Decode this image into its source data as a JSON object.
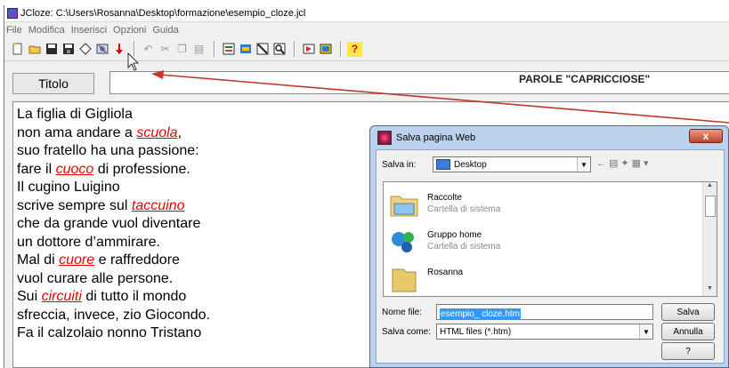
{
  "window": {
    "title": "JCloze: C:\\Users\\Rosanna\\Desktop\\formazione\\esempio_cloze.jcl"
  },
  "menu": [
    "File",
    "Modifica",
    "Inserisci",
    "Opzioni",
    "Guida"
  ],
  "toolbar": {
    "icons": [
      "new-file-icon",
      "open-folder-icon",
      "save-icon",
      "save-as-icon",
      "eraser-icon",
      "export-web-icon",
      "arrow-down-icon",
      "undo-icon",
      "cut-icon",
      "copy-icon",
      "paste-icon",
      "gap-icon",
      "gap-edit-icon",
      "clear-gap-icon",
      "find-gap-icon",
      "config-icon",
      "export-icon",
      "help-icon"
    ],
    "help_label": "?"
  },
  "title_row": {
    "button_label": "Titolo",
    "value": "PAROLE \"CAPRICCIOSE\""
  },
  "poem": [
    [
      {
        "t": "La figlia di Gigliola",
        "g": false
      }
    ],
    [
      {
        "t": "non ama andare a ",
        "g": false
      },
      {
        "t": "scuola",
        "g": true
      },
      {
        "t": ",",
        "g": false
      }
    ],
    [
      {
        "t": "suo fratello ha una passione:",
        "g": false
      }
    ],
    [
      {
        "t": "fare il ",
        "g": false
      },
      {
        "t": "cuoco",
        "g": true
      },
      {
        "t": " di professione.",
        "g": false
      }
    ],
    [
      {
        "t": "Il cugino Luigino",
        "g": false
      }
    ],
    [
      {
        "t": "scrive sempre sul ",
        "g": false
      },
      {
        "t": "taccuino ",
        "g": true
      }
    ],
    [
      {
        "t": "che da grande vuol diventare",
        "g": false
      }
    ],
    [
      {
        "t": "un dottore d’ammirare.",
        "g": false
      }
    ],
    [
      {
        "t": "Mal di ",
        "g": false
      },
      {
        "t": "cuore",
        "g": true
      },
      {
        "t": " e raffreddore",
        "g": false
      }
    ],
    [
      {
        "t": "vuol curare alle persone.",
        "g": false
      }
    ],
    [
      {
        "t": "Sui ",
        "g": false
      },
      {
        "t": "circuiti",
        "g": true
      },
      {
        "t": " di tutto il mondo",
        "g": false
      }
    ],
    [
      {
        "t": "sfreccia, invece, zio Giocondo.",
        "g": false
      }
    ],
    [
      {
        "t": "Fa il calzolaio nonno Tristano",
        "g": false
      }
    ]
  ],
  "dialog": {
    "title": "Salva pagina Web",
    "close_label": "x",
    "save_in_label": "Salva in:",
    "save_in_value": "Desktop",
    "items": [
      {
        "name": "Raccolte",
        "sub": "Cartella di sistema",
        "icon": "folder-library-icon"
      },
      {
        "name": "Gruppo home",
        "sub": "Cartella di sistema",
        "icon": "homegroup-icon"
      },
      {
        "name": "Rosanna",
        "sub": "",
        "icon": "user-folder-icon"
      }
    ],
    "filename_label": "Nome file:",
    "filename_value": "esempio_ cloze.htm",
    "savetype_label": "Salva come:",
    "savetype_value": "HTML files (*.htm)",
    "save_button": "Salva",
    "cancel_button": "Annulla",
    "help_button": "?"
  },
  "colors": {
    "gap": "#e00000",
    "arrow": "#c0392b",
    "dialog_frame": "#bcd2ec"
  }
}
